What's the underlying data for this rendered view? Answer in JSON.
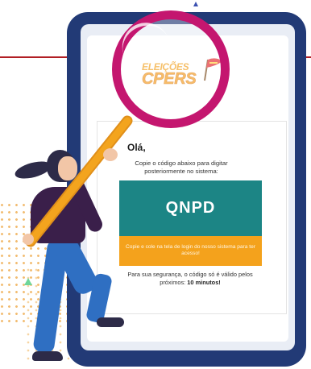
{
  "brand": {
    "logo_line1": "ELEIÇÕES",
    "logo_line2": "CPERS"
  },
  "email": {
    "greeting": "Olá,",
    "instruction": "Copie o código abaixo para digitar posteriormente no sistema:",
    "code": "QNPD",
    "paste_hint": "Copie e cole na tela de login do nosso sistema para ter acesso!",
    "footer_prefix": "Para sua segurança, o código só é válido pelos próximos: ",
    "footer_bold": "10 minutos!"
  },
  "colors": {
    "phone": "#223a76",
    "code_bg": "#1c8585",
    "hint_bg": "#f4a21c",
    "magnifier": "#c4166f",
    "accent_line": "#b11f24"
  },
  "icons": [
    "magnifier-illustration",
    "flag-logo-icon"
  ]
}
